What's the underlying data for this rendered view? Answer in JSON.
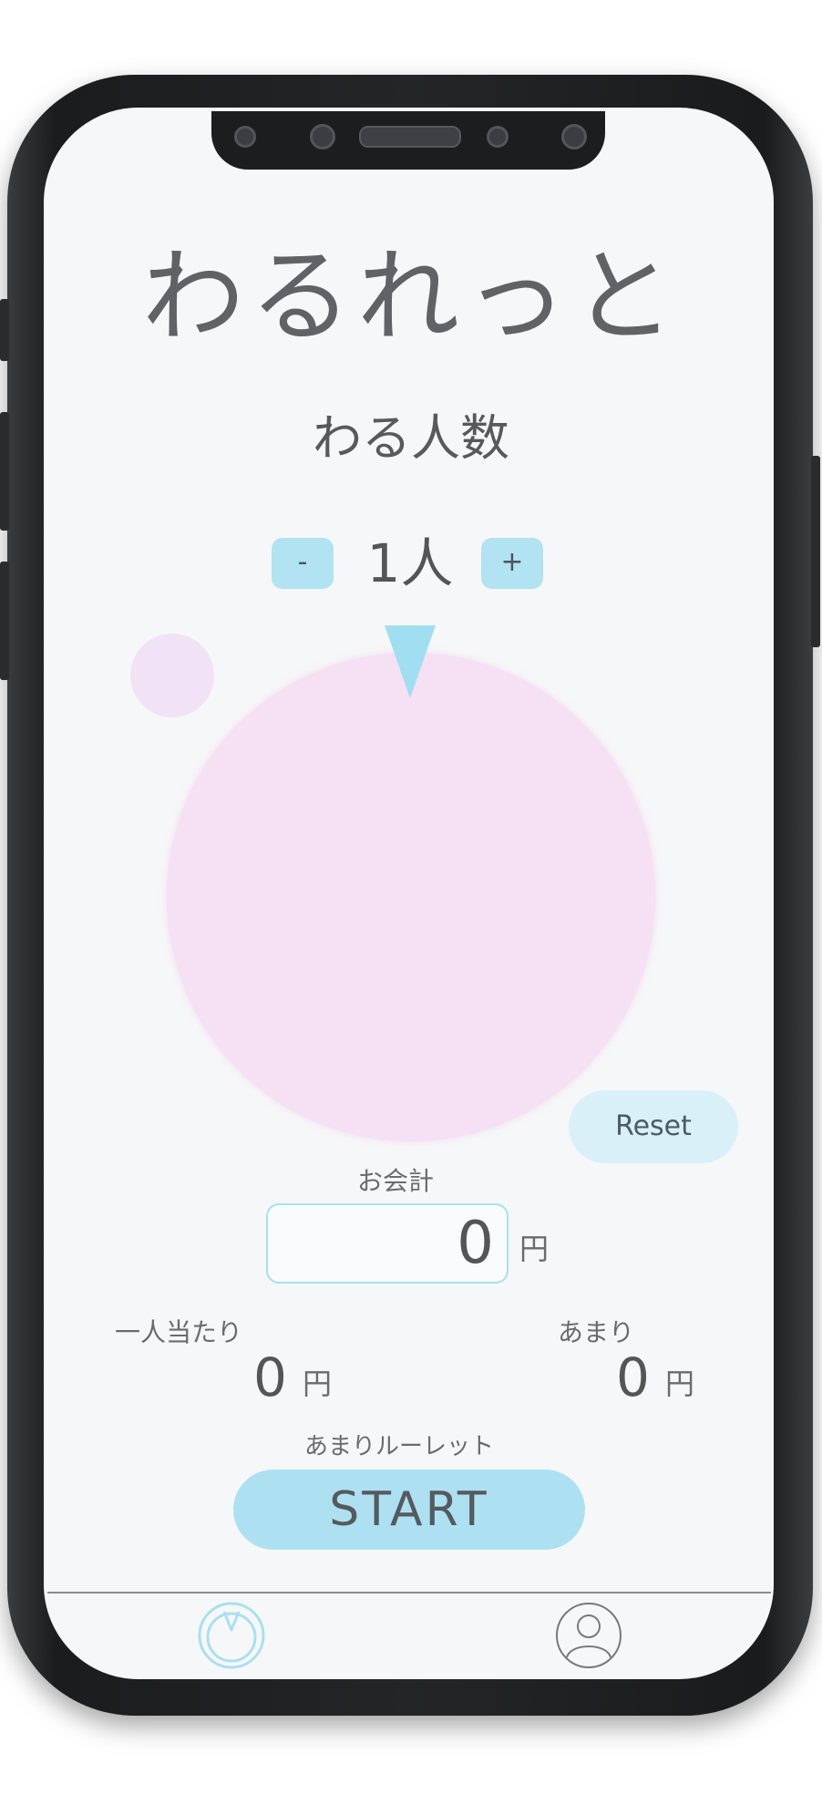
{
  "app": {
    "title": "わるれっと",
    "subtitle": "わる人数"
  },
  "people": {
    "minus_label": "-",
    "count": "1人",
    "plus_label": "+"
  },
  "reset_label": "Reset",
  "bill": {
    "label": "お会計",
    "value": "0",
    "unit": "円"
  },
  "per_person": {
    "label": "一人当たり",
    "value": "0",
    "unit": "円"
  },
  "remainder": {
    "label": "あまり",
    "value": "0",
    "unit": "円"
  },
  "roulette": {
    "label": "あまりルーレット",
    "start_label": "START"
  },
  "tabs": [
    {
      "icon": "roulette-icon",
      "active": true
    },
    {
      "icon": "profile-icon",
      "active": false
    }
  ],
  "colors": {
    "accent": "#ade1f2",
    "wheel": "#f6e0f3",
    "background": "#f6f7f8"
  }
}
